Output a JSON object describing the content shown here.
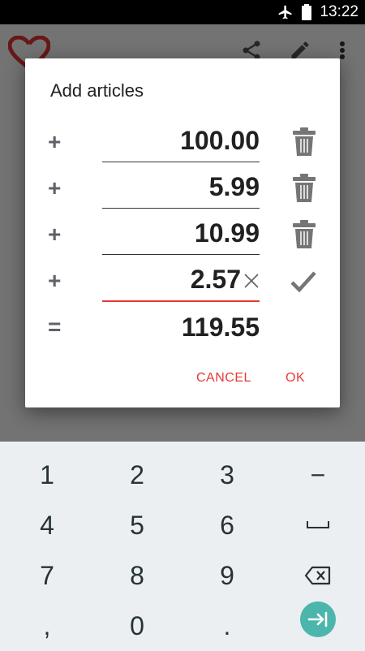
{
  "status_bar": {
    "time": "13:22",
    "airplane_icon": "airplane-mode-icon",
    "battery_icon": "battery-icon"
  },
  "background_app": {
    "icons": [
      "heart-logo-icon",
      "share-icon",
      "edit-pencil-icon",
      "overflow-menu-icon"
    ]
  },
  "dialog": {
    "title": "Add articles",
    "rows": [
      {
        "operator": "+",
        "value": "100.00"
      },
      {
        "operator": "+",
        "value": "5.99"
      },
      {
        "operator": "+",
        "value": "10.99"
      },
      {
        "operator": "+",
        "value": "2.57",
        "active": true
      }
    ],
    "total": {
      "operator": "=",
      "value": "119.55"
    },
    "cancel_label": "CANCEL",
    "ok_label": "OK"
  },
  "keypad": {
    "keys": [
      [
        "1",
        "2",
        "3",
        "−"
      ],
      [
        "4",
        "5",
        "6",
        "␣"
      ],
      [
        "7",
        "8",
        "9",
        "backspace"
      ],
      [
        ",",
        "0",
        ".",
        "next"
      ]
    ]
  },
  "colors": {
    "accent": "#e53935",
    "fab": "#4db6ac",
    "keypad_bg": "#eceff1"
  }
}
